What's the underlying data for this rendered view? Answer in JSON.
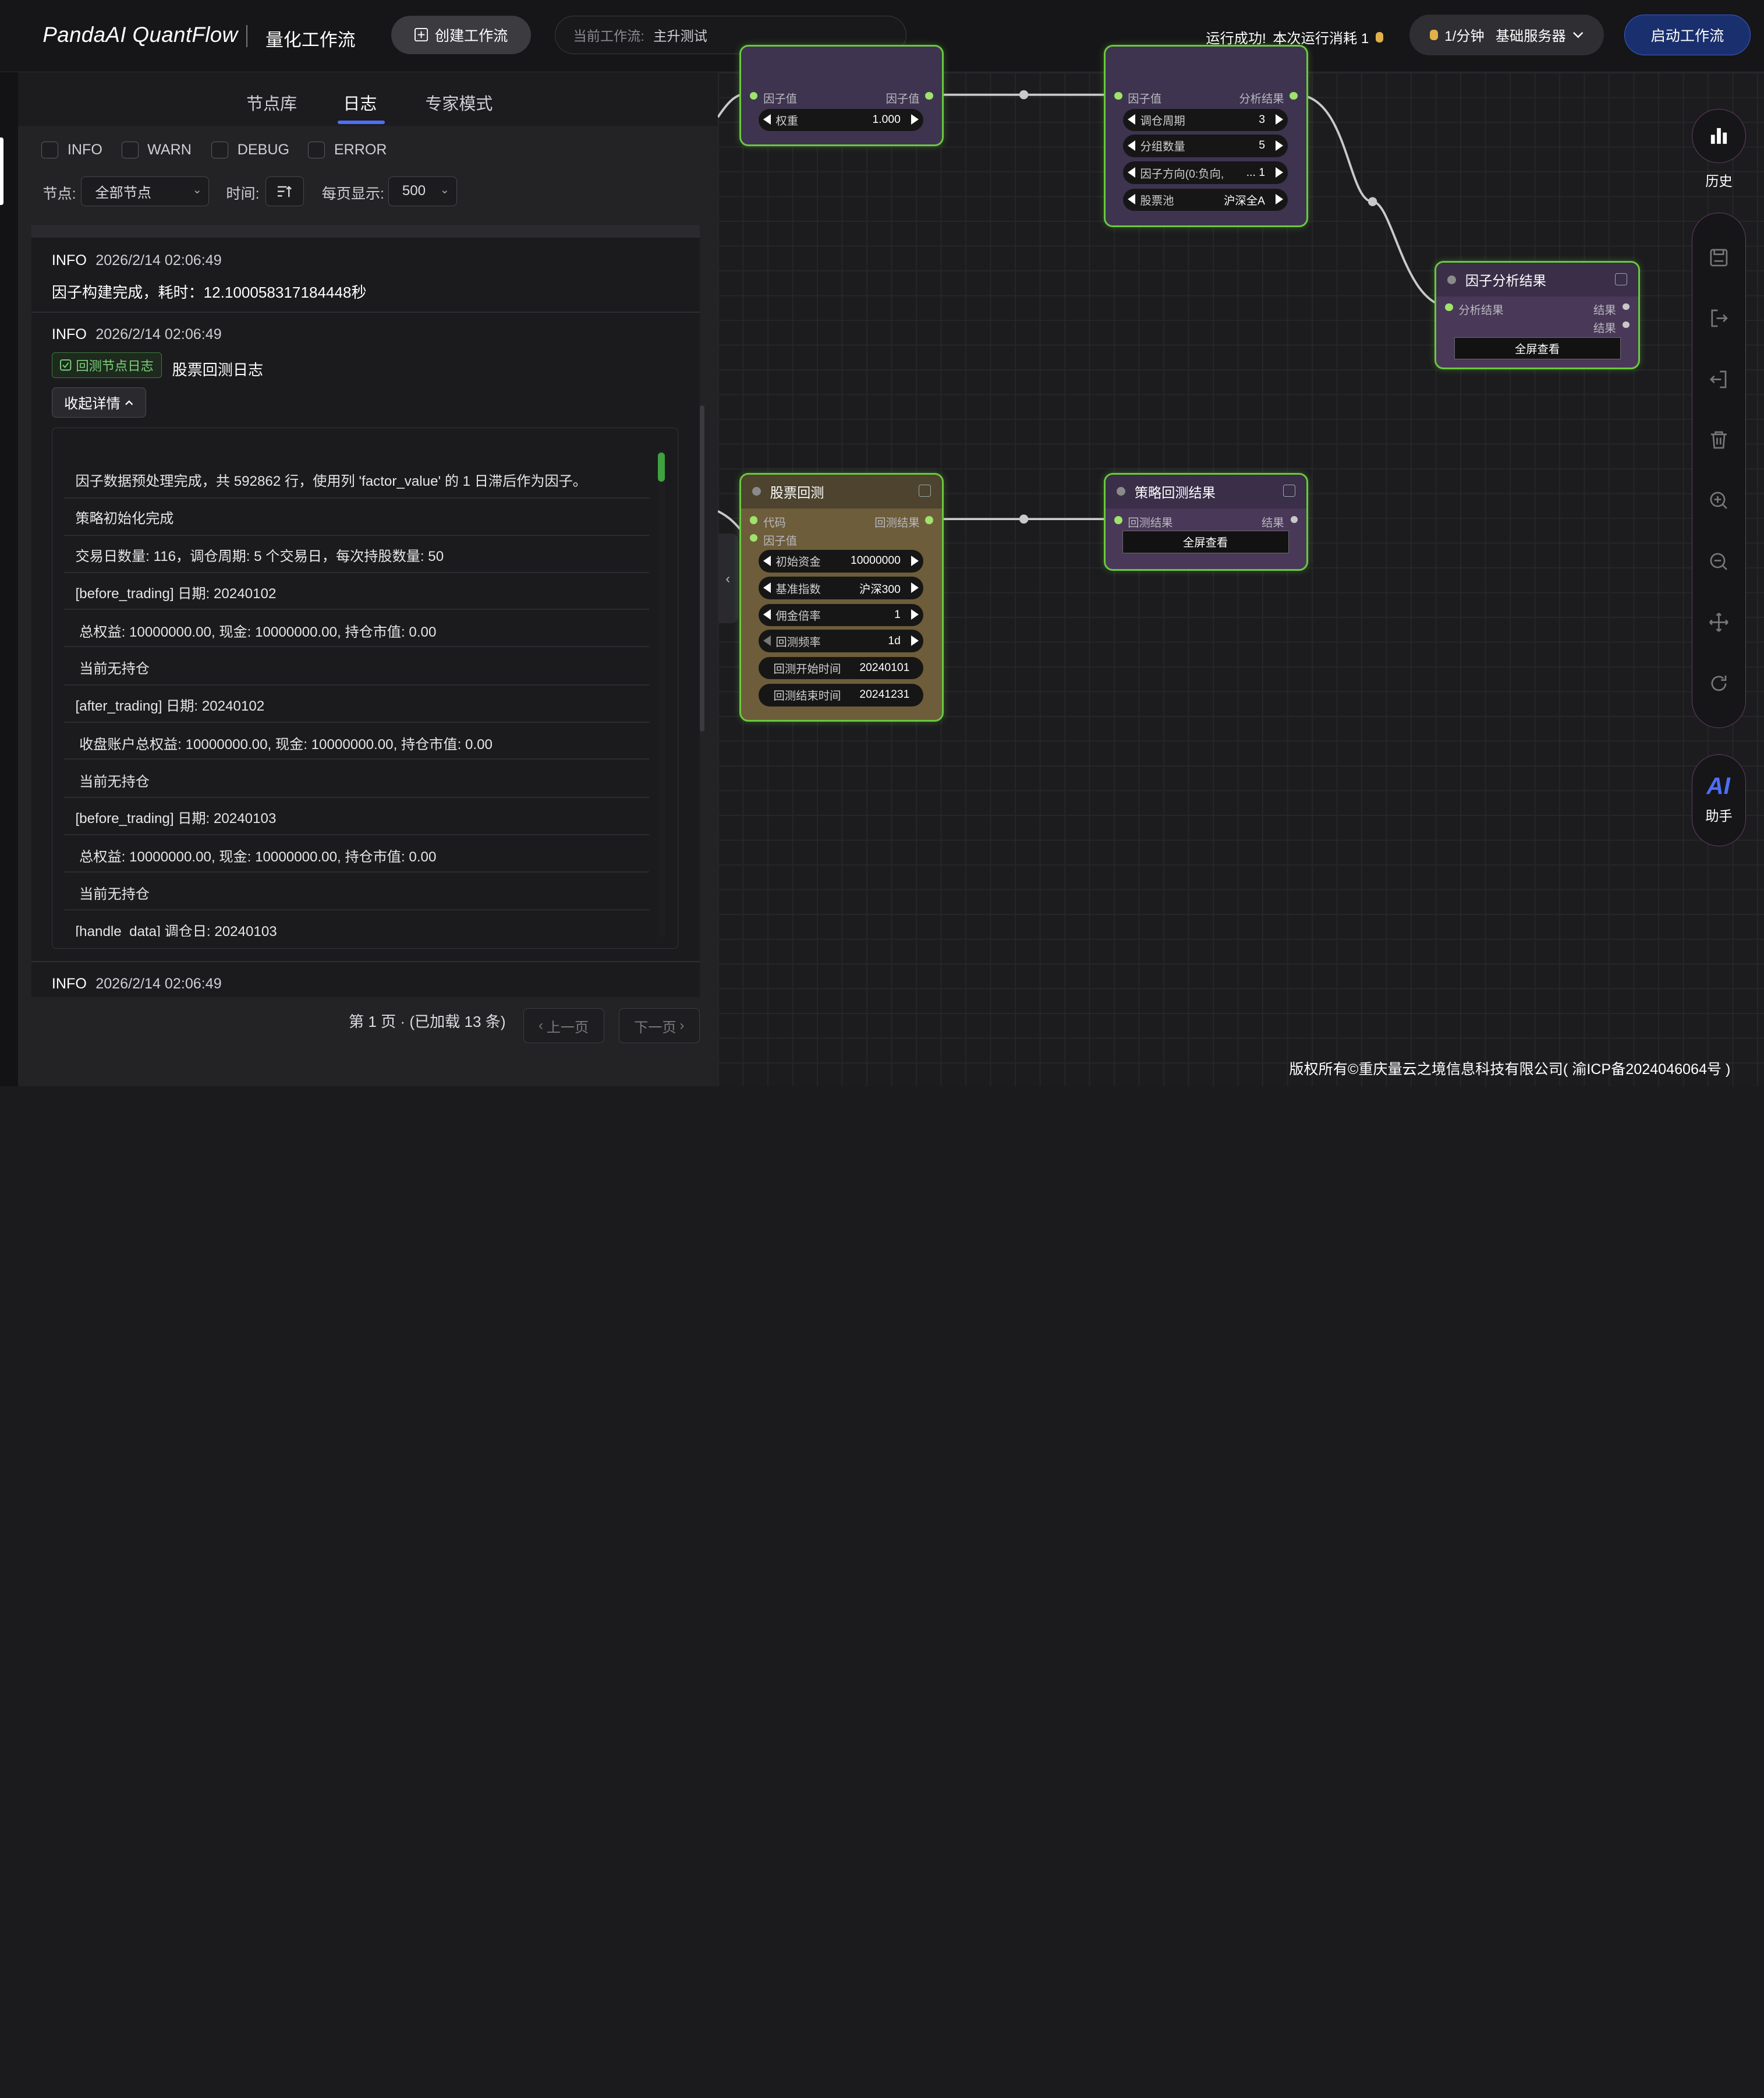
{
  "header": {
    "logo": "PandaAI QuantFlow",
    "subtitle": "量化工作流",
    "create_btn": "创建工作流",
    "current_wf_label": "当前工作流:",
    "current_wf_value": "主升测试",
    "run_status": "运行成功!",
    "run_cost": "本次运行消耗 1",
    "server_rate": "1/分钟",
    "server_name": "基础服务器",
    "start_btn": "启动工作流"
  },
  "panel": {
    "tabs": [
      "节点库",
      "日志",
      "专家模式"
    ],
    "active_tab": "日志",
    "levels": [
      "INFO",
      "WARN",
      "DEBUG",
      "ERROR"
    ],
    "node_label": "节点:",
    "node_value": "全部节点",
    "time_label": "时间:",
    "per_page_label": "每页显示:",
    "per_page_value": "500"
  },
  "logs": [
    {
      "level": "INFO",
      "time": "2026/2/14 02:06:49",
      "message": "因子构建完成，耗时：12.100058317184448秒"
    },
    {
      "level": "INFO",
      "time": "2026/2/14 02:06:49",
      "badge": "回测节点日志",
      "message": "股票回测日志",
      "collapse_label": "收起详情",
      "details": [
        "因子数据预处理完成，共 592862 行，使用列 'factor_value' 的 1 日滞后作为因子。",
        "策略初始化完成",
        "交易日数量: 116，调仓周期: 5 个交易日，每次持股数量: 50",
        "[before_trading] 日期: 20240102",
        " 总权益: 10000000.00, 现金: 10000000.00, 持仓市值: 0.00",
        " 当前无持仓",
        "[after_trading] 日期: 20240102",
        " 收盘账户总权益: 10000000.00, 现金: 10000000.00, 持仓市值: 0.00",
        " 当前无持仓",
        "[before_trading] 日期: 20240103",
        " 总权益: 10000000.00, 现金: 10000000.00, 持仓市值: 0.00",
        " 当前无持仓",
        "[handle_data] 调仓日: 20240103"
      ]
    },
    {
      "level": "INFO",
      "time": "2026/2/14 02:06:49"
    }
  ],
  "pager": {
    "info": "第 1 页 · (已加载 13 条)",
    "prev": "上一页",
    "next": "下一页"
  },
  "nodes": {
    "top_left": {
      "in_label": "因子值",
      "out_label": "因子值",
      "weight_label": "权重",
      "weight_value": "1.000"
    },
    "top_mid": {
      "in_label": "因子值",
      "out_label": "分析结果",
      "params": [
        {
          "label": "调仓周期",
          "value": "3"
        },
        {
          "label": "分组数量",
          "value": "5"
        },
        {
          "label": "因子方向(0:负向,",
          "value": "... 1"
        },
        {
          "label": "股票池",
          "value": "沪深全A"
        }
      ]
    },
    "factor_result": {
      "title": "因子分析结果",
      "in_label": "分析结果",
      "out1": "结果",
      "out2": "结果",
      "fullscreen": "全屏查看"
    },
    "backtest": {
      "title": "股票回测",
      "in1": "代码",
      "in2": "因子值",
      "out_label": "回测结果",
      "params": [
        {
          "label": "初始资金",
          "value": "10000000"
        },
        {
          "label": "基准指数",
          "value": "沪深300"
        },
        {
          "label": "佣金倍率",
          "value": "1"
        },
        {
          "label": "回测频率",
          "value": "1d"
        },
        {
          "label": "回测开始时间",
          "value": "20240101"
        },
        {
          "label": "回测结束时间",
          "value": "20241231"
        }
      ]
    },
    "strategy_result": {
      "title": "策略回测结果",
      "in_label": "回测结果",
      "out_label": "结果",
      "fullscreen": "全屏查看"
    }
  },
  "toolbar": {
    "history": "历史",
    "ai_logo": "AI",
    "ai_label": "助手"
  },
  "footer": "版权所有©重庆量云之境信息科技有限公司( 渝ICP备2024046064号 )",
  "colors": {
    "accent": "#4d6ef5",
    "node_border": "#69c93e",
    "purple_node": "#4a3858",
    "brown_node": "#6e5d3a"
  }
}
